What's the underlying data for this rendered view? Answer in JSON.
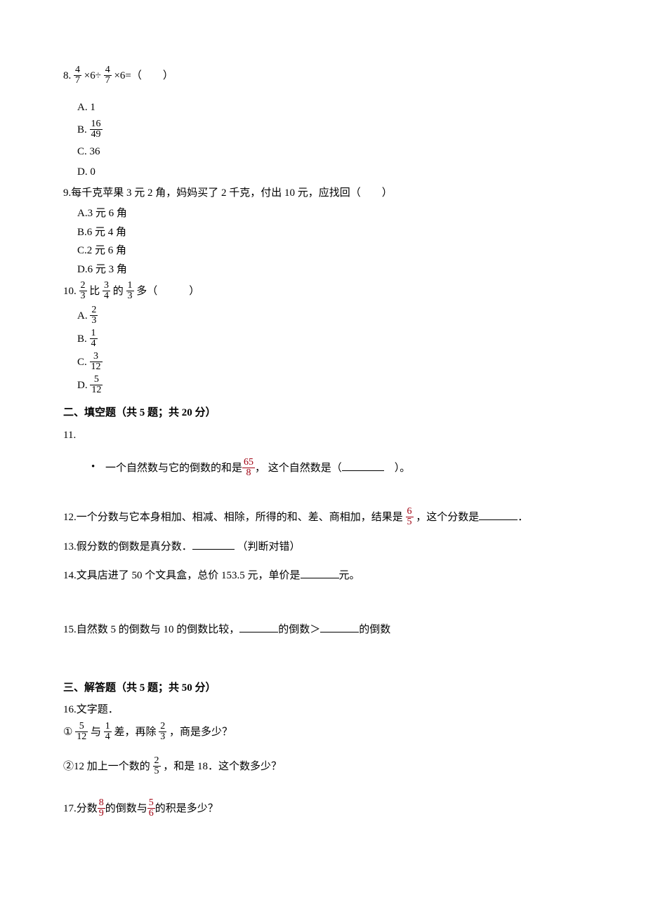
{
  "q8": {
    "stem_prefix": "8.",
    "f1_num": "4",
    "f1_den": "7",
    "mid1": "×6÷ ",
    "f2_num": "4",
    "f2_den": "7",
    "mid2": "×6=（　　）",
    "A": "A. 1",
    "B_prefix": "B.",
    "B_num": "16",
    "B_den": "49",
    "C": "C. 36",
    "D": "D. 0"
  },
  "q9": {
    "stem": "9.每千克苹果 3 元 2 角，妈妈买了 2 千克，付出 10 元，应找回（　　）",
    "A": "A.3 元 6 角",
    "B": "B.6 元 4 角",
    "C": "C.2 元 6 角",
    "D": "D.6 元 3 角"
  },
  "q10": {
    "stem_prefix": "10.",
    "f1_num": "2",
    "f1_den": "3",
    "mid1": "比 ",
    "f2_num": "3",
    "f2_den": "4",
    "mid2": "的 ",
    "f3_num": "1",
    "f3_den": "3",
    "mid3": "多（　　　）",
    "A_prefix": "A.",
    "A_num": "2",
    "A_den": "3",
    "B_prefix": "B.",
    "B_num": "1",
    "B_den": "4",
    "C_prefix": "C.",
    "C_num": "3",
    "C_den": "12",
    "D_prefix": "D.",
    "D_num": "5",
    "D_den": "12"
  },
  "section2": "二、填空题（共 5 题；共 20 分）",
  "q11": {
    "label": "11.",
    "text_before": "一个自然数与它的倒数的和是",
    "f_num": "65",
    "f_den": "8",
    "text_mid": "， 这个自然数是（",
    "text_after": "　）。"
  },
  "q12": {
    "text_before": "12.一个分数与它本身相加、相减、相除，所得的和、差、商相加，结果是 ",
    "f_num": "6",
    "f_den": "5",
    "text_mid": "，这个分数是",
    "text_after": "．"
  },
  "q13": {
    "text_before": "13.假分数的倒数是真分数．",
    "text_after": "（判断对错）"
  },
  "q14": {
    "text_before": "14.文具店进了 50 个文具盒，总价 153.5 元，单价是",
    "text_after": "元。"
  },
  "q15": {
    "text_before": "15.自然数 5 的倒数与 10 的倒数比较，",
    "text_mid": "的倒数＞",
    "text_after": "的倒数"
  },
  "section3": "三、解答题（共 5 题；共 50 分）",
  "q16": {
    "title": "16.文字题．",
    "p1_prefix": "① ",
    "p1_f1_num": "5",
    "p1_f1_den": "12",
    "p1_mid1": "与 ",
    "p1_f2_num": "1",
    "p1_f2_den": "4",
    "p1_mid2": "差，再除 ",
    "p1_f3_num": "2",
    "p1_f3_den": "3",
    "p1_end": "，商是多少？",
    "p2_prefix": "②12 加上一个数的 ",
    "p2_f_num": "2",
    "p2_f_den": "5",
    "p2_end": "，和是 18．这个数多少？"
  },
  "q17": {
    "text_before": "17.分数",
    "f1_num": "8",
    "f1_den": "9",
    "mid": "的倒数与",
    "f2_num": "5",
    "f2_den": "6",
    "text_after": "的积是多少？"
  }
}
